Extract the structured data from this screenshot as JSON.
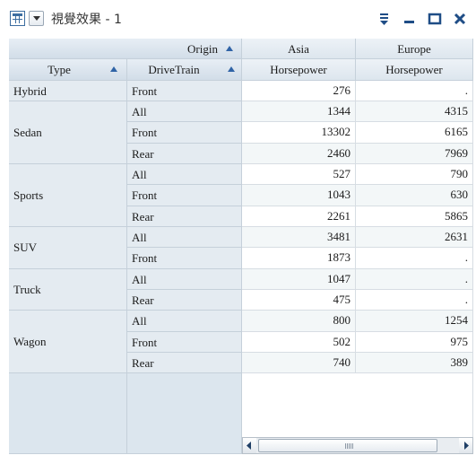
{
  "window": {
    "title": "視覺效果 - 1",
    "icons": [
      "table-view-icon",
      "dropdown-arrow-icon",
      "menu-icon",
      "minimize-icon",
      "maximize-icon",
      "close-icon"
    ]
  },
  "header": {
    "column_variable": "Origin",
    "columns": [
      "Asia",
      "Europe"
    ],
    "measure": "Horsepower",
    "row_variables": [
      "Type",
      "DriveTrain"
    ]
  },
  "rows": [
    {
      "type": "Hybrid",
      "drivetrain": "Front",
      "asia": "276",
      "europe": "."
    },
    {
      "type": "Sedan",
      "drivetrain": "All",
      "asia": "1344",
      "europe": "4315"
    },
    {
      "type": "",
      "drivetrain": "Front",
      "asia": "13302",
      "europe": "6165"
    },
    {
      "type": "",
      "drivetrain": "Rear",
      "asia": "2460",
      "europe": "7969"
    },
    {
      "type": "Sports",
      "drivetrain": "All",
      "asia": "527",
      "europe": "790"
    },
    {
      "type": "",
      "drivetrain": "Front",
      "asia": "1043",
      "europe": "630"
    },
    {
      "type": "",
      "drivetrain": "Rear",
      "asia": "2261",
      "europe": "5865"
    },
    {
      "type": "SUV",
      "drivetrain": "All",
      "asia": "3481",
      "europe": "2631"
    },
    {
      "type": "",
      "drivetrain": "Front",
      "asia": "1873",
      "europe": "."
    },
    {
      "type": "Truck",
      "drivetrain": "All",
      "asia": "1047",
      "europe": "."
    },
    {
      "type": "",
      "drivetrain": "Rear",
      "asia": "475",
      "europe": "."
    },
    {
      "type": "Wagon",
      "drivetrain": "All",
      "asia": "800",
      "europe": "1254"
    },
    {
      "type": "",
      "drivetrain": "Front",
      "asia": "502",
      "europe": "975"
    },
    {
      "type": "",
      "drivetrain": "Rear",
      "asia": "740",
      "europe": "389"
    }
  ],
  "type_groups": [
    {
      "label": "Hybrid",
      "span": 1
    },
    {
      "label": "Sedan",
      "span": 3
    },
    {
      "label": "Sports",
      "span": 3
    },
    {
      "label": "SUV",
      "span": 2
    },
    {
      "label": "Truck",
      "span": 2
    },
    {
      "label": "Wagon",
      "span": 3
    }
  ],
  "colors": {
    "accent": "#2f63a6",
    "header": "#d8e2eb",
    "row_header": "#e4ebf1"
  }
}
